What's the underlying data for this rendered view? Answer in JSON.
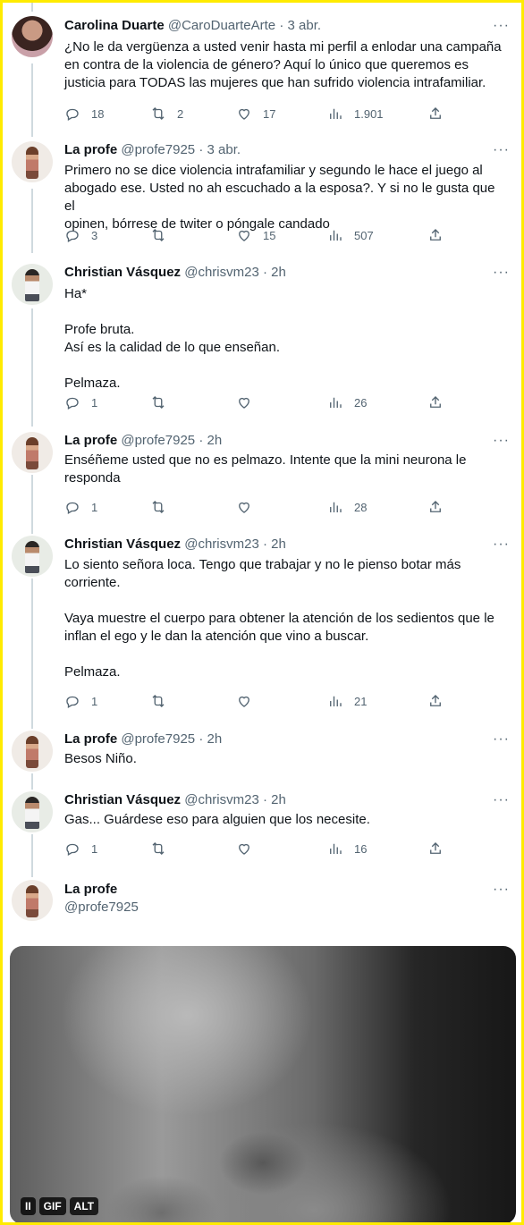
{
  "tweets": [
    {
      "name": "Carolina Duarte",
      "handle": "@CaroDuarteArte",
      "time": "3 abr.",
      "text": [
        "¿No le da vergüenza a usted venir hasta mi perfil a enlodar una campaña",
        "en contra de la violencia de género? Aquí lo único que queremos es",
        "justicia para TODAS las mujeres que han sufrido violencia intrafamiliar."
      ],
      "stats": {
        "replies": "18",
        "retweets": "2",
        "likes": "17",
        "views": "1.901"
      },
      "avatar": "avatar-carolina"
    },
    {
      "name": "La profe",
      "handle": "@profe7925",
      "time": "3 abr.",
      "text": [
        "Primero no se dice violencia intrafamiliar y segundo le hace el juego al",
        "abogado ese. Usted no ah escuchado a la esposa?. Y si no le gusta que el",
        "opinen, bórrese de twiter o póngale candado"
      ],
      "stats": {
        "replies": "3",
        "retweets": "",
        "likes": "15",
        "views": "507"
      },
      "avatar": "avatar-profe"
    },
    {
      "name": "Christian Vásquez",
      "handle": "@chrisvm23",
      "time": "2h",
      "text": [
        "Ha*",
        "",
        "Profe bruta.",
        "Así es la calidad de lo que enseñan.",
        "",
        "Pelmaza."
      ],
      "stats": {
        "replies": "1",
        "retweets": "",
        "likes": "",
        "views": "26"
      },
      "avatar": "avatar-christian"
    },
    {
      "name": "La profe",
      "handle": "@profe7925",
      "time": "2h",
      "text": [
        "Enséñeme usted que no es pelmazo. Intente que la mini neurona le",
        "responda"
      ],
      "stats": {
        "replies": "1",
        "retweets": "",
        "likes": "",
        "views": "28"
      },
      "avatar": "avatar-profe"
    },
    {
      "name": "Christian Vásquez",
      "handle": "@chrisvm23",
      "time": "2h",
      "text": [
        "Lo siento señora loca. Tengo que trabajar y no le pienso botar más",
        "corriente.",
        "",
        "Vaya muestre el cuerpo para obtener la atención de los sedientos que le",
        "inflan el ego y le dan la atención que vino a buscar.",
        "",
        "Pelmaza."
      ],
      "stats": {
        "replies": "1",
        "retweets": "",
        "likes": "",
        "views": "21"
      },
      "avatar": "avatar-christian"
    },
    {
      "name": "La profe",
      "handle": "@profe7925",
      "time": "2h",
      "text": [
        "Besos Niño."
      ],
      "stats": null,
      "avatar": "avatar-profe"
    },
    {
      "name": "Christian Vásquez",
      "handle": "@chrisvm23",
      "time": "2h",
      "text": [
        "Gas... Guárdese eso para alguien que los necesite."
      ],
      "stats": {
        "replies": "1",
        "retweets": "",
        "likes": "",
        "views": "16"
      },
      "avatar": "avatar-christian"
    }
  ],
  "final": {
    "name": "La profe",
    "handle": "@profe7925"
  },
  "media": {
    "pause": "II",
    "gif": "GIF",
    "alt": "ALT"
  },
  "icons": {
    "reply": "reply-icon",
    "retweet": "retweet-icon",
    "like": "heart-icon",
    "views": "views-icon",
    "share": "share-icon",
    "more": "more-icon"
  },
  "colors": {
    "border": "#ffeb00",
    "text": "#0f1419",
    "muted": "#536471",
    "thread": "#cfd9de"
  },
  "more_label": "···",
  "separator": "·"
}
